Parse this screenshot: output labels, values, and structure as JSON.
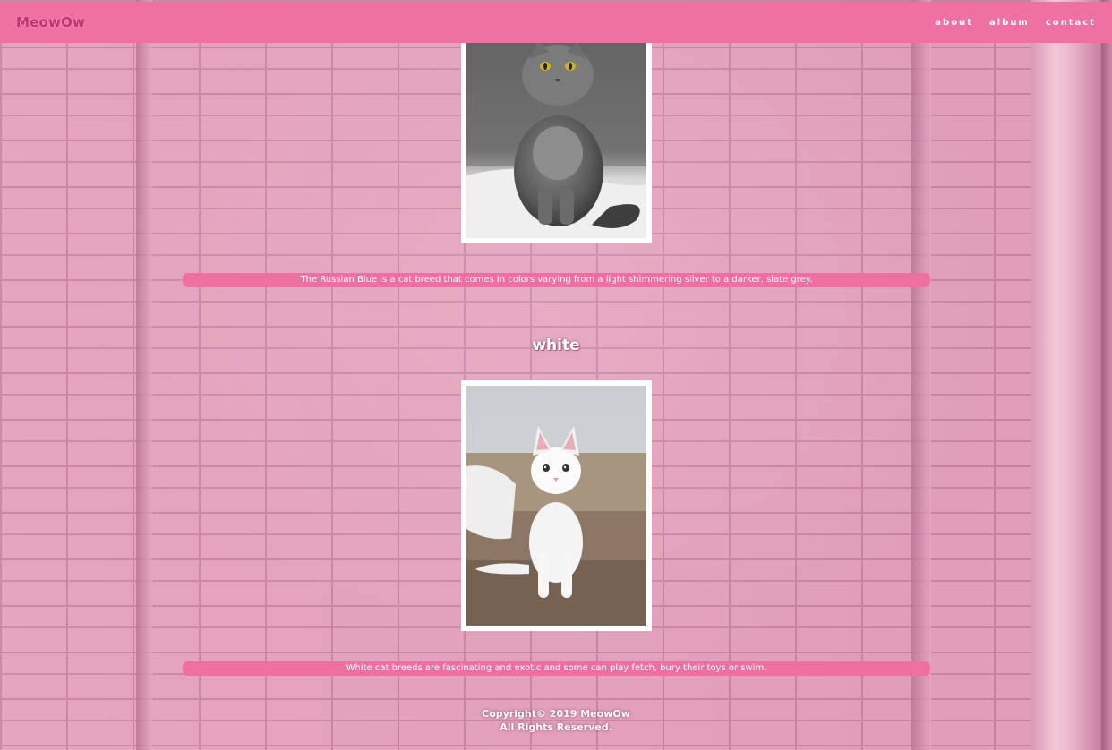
{
  "navbar": {
    "brand": "MeowOw",
    "links": [
      "about",
      "album",
      "contact"
    ]
  },
  "gallery": {
    "sections": [
      {
        "title": "",
        "caption": "The Russian Blue is a cat breed that comes in colors varying from a light shimmering silver to a darker, slate grey."
      },
      {
        "title": "white",
        "caption": "White cat breeds are fascinating and exotic and some can play fetch, bury their toys or swim."
      }
    ]
  },
  "footer": {
    "copyright": "Copyright© 2019 MeowOw",
    "rights": "All Rights Reserved."
  },
  "colors": {
    "navbar": "#ef71a1",
    "caption_bar": "#ef6fa0",
    "brand": "#b9376e",
    "wall": "#e4a0bb"
  }
}
